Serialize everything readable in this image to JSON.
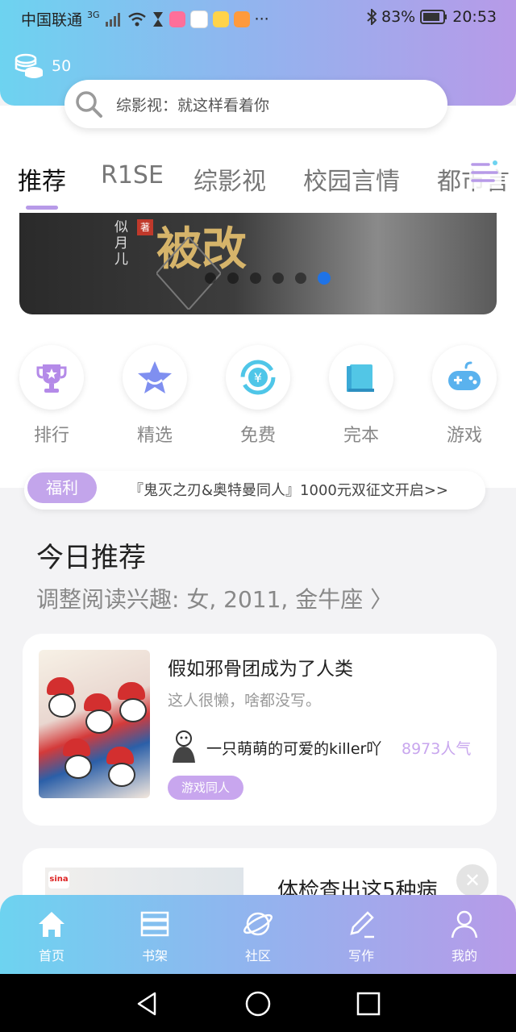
{
  "status_bar": {
    "carrier": "中国联通",
    "network": "3G",
    "more": "···",
    "battery": "83%",
    "time": "20:53",
    "app_icon_colors": [
      "#ff6f9a",
      "#ff4b4b",
      "#ffd34a",
      "#ff9a3c"
    ]
  },
  "header": {
    "coin_count": "50",
    "search_placeholder": "综影视：就这样看着你"
  },
  "tabs": {
    "items": [
      "推荐",
      "R1SE",
      "综影视",
      "校园言情",
      "都市言"
    ],
    "active_index": 0
  },
  "banner": {
    "title_art": "被改",
    "author_art": "似月儿",
    "author_mark": "著",
    "slide_count": 6,
    "active_slide": 5
  },
  "shortcuts": [
    {
      "label": "排行",
      "icon": "trophy-icon"
    },
    {
      "label": "精选",
      "icon": "star-icon"
    },
    {
      "label": "免费",
      "icon": "yuan-refresh-icon"
    },
    {
      "label": "完本",
      "icon": "book-icon"
    },
    {
      "label": "游戏",
      "icon": "gamepad-icon"
    }
  ],
  "welfare": {
    "tag": "福利",
    "text": "『鬼灭之刃&奥特曼同人』1000元双征文开启>>"
  },
  "today": {
    "title": "今日推荐",
    "subtitle": "调整阅读兴趣: 女, 2011, 金牛座 〉"
  },
  "book_card": {
    "title": "假如邪骨团成为了人类",
    "description": "这人很懒，啥都没写。",
    "author": "一只萌萌的可爱的killer吖",
    "popularity": "8973人气",
    "genre_tag": "游戏同人"
  },
  "ad_card": {
    "logo_text": "sina",
    "title": "体检查出这5种病",
    "close_symbol": "✕"
  },
  "bottom_nav": [
    {
      "label": "首页",
      "icon": "home-icon"
    },
    {
      "label": "书架",
      "icon": "bookshelf-icon"
    },
    {
      "label": "社区",
      "icon": "planet-icon"
    },
    {
      "label": "写作",
      "icon": "pen-icon"
    },
    {
      "label": "我的",
      "icon": "user-icon"
    }
  ],
  "colors": {
    "gradient_start": "#6dd3f0",
    "gradient_end": "#b79ae8",
    "accent_purple": "#c3a5eb",
    "active_dot": "#1f73e6"
  }
}
